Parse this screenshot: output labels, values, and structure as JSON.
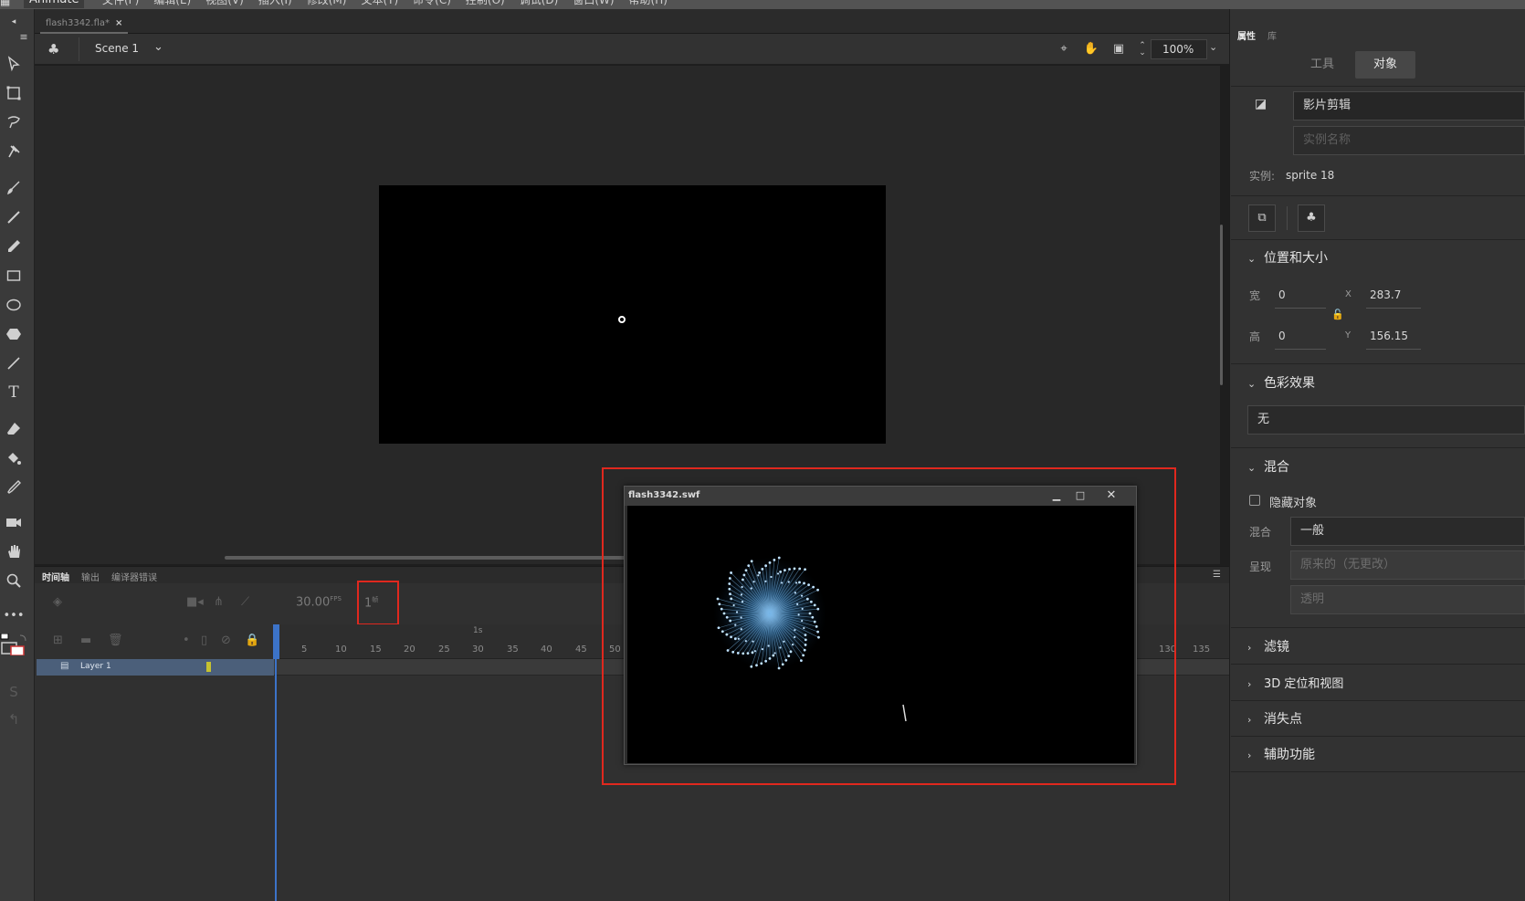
{
  "app": {
    "name": "Animate",
    "menus": [
      "文件(F)",
      "编辑(E)",
      "视图(V)",
      "插入(I)",
      "修改(M)",
      "文本(T)",
      "命令(C)",
      "控制(O)",
      "调试(D)",
      "窗口(W)",
      "帮助(H)"
    ]
  },
  "document": {
    "tab_title": "flash3342.fla*",
    "close_glyph": "×"
  },
  "editbar": {
    "scene_name": "Scene 1",
    "zoom": "100%"
  },
  "timeline": {
    "tabs": [
      "时间轴",
      "输出",
      "编译器错误"
    ],
    "fps_value": "30.00",
    "fps_unit": "FPS",
    "current_frame": "1",
    "frame_unit": "帧",
    "second_marker": "1s",
    "ruler_ticks": [
      "5",
      "10",
      "15",
      "20",
      "25",
      "30",
      "35",
      "40",
      "45",
      "50",
      "130",
      "135"
    ],
    "layer_name": "Layer 1"
  },
  "properties": {
    "tabs": [
      "属性",
      "库"
    ],
    "mode_buttons": [
      "工具",
      "对象"
    ],
    "instance_type": "影片剪辑",
    "instance_name_placeholder": "实例名称",
    "instance_label": "实例:",
    "instance_value": "sprite 18",
    "position_section": "位置和大小",
    "width_label": "宽",
    "width_value": "0",
    "height_label": "高",
    "height_value": "0",
    "x_label": "X",
    "x_value": "283.7",
    "y_label": "Y",
    "y_value": "156.15",
    "color_section": "色彩效果",
    "color_value": "无",
    "blend_section": "混合",
    "hide_object_label": "隐藏对象",
    "blend_label": "混合",
    "blend_value": "一般",
    "render_label": "呈现",
    "render_value": "原来的（无更改）",
    "transparent_value": "透明",
    "filters_section": "滤镜",
    "threed_section": "3D 定位和视图",
    "vanishing_section": "消失点",
    "accessibility_section": "辅助功能"
  },
  "swf_window": {
    "title": "flash3342.swf",
    "highlight_color": "#e0281e"
  },
  "colors": {
    "playhead": "#3c73c8",
    "layer_color": "#c6c230",
    "selected_layer": "#4b5f7a"
  }
}
